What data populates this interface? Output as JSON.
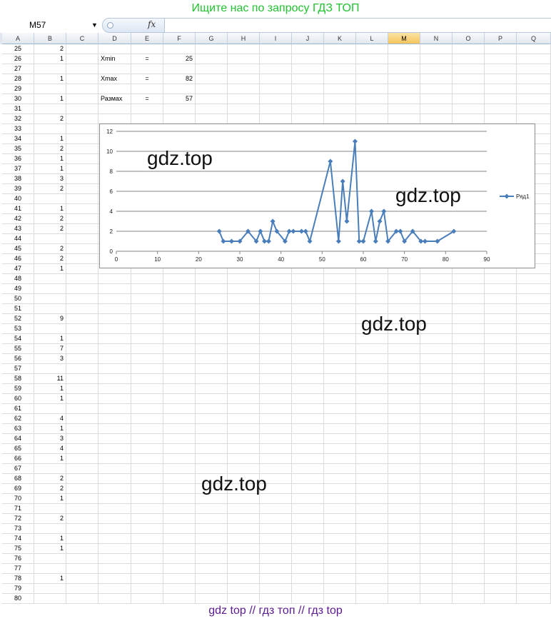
{
  "banner": "Ищите нас по запросу ГДЗ ТОП",
  "formula_bar": {
    "name_box": "M57",
    "fx_label": "fx",
    "formula_value": ""
  },
  "columns": [
    "A",
    "B",
    "C",
    "D",
    "E",
    "F",
    "G",
    "H",
    "I",
    "J",
    "K",
    "L",
    "M",
    "N",
    "O",
    "P",
    "Q"
  ],
  "active_column": "M",
  "rows": [
    {
      "n": "25",
      "b": "2"
    },
    {
      "n": "26",
      "b": "1",
      "d": "Xmin",
      "e": "=",
      "f": "25"
    },
    {
      "n": "27"
    },
    {
      "n": "28",
      "b": "1",
      "d": "Xmax",
      "e": "=",
      "f": "82"
    },
    {
      "n": "29"
    },
    {
      "n": "30",
      "b": "1",
      "d": "Размах",
      "e": "=",
      "f": "57"
    },
    {
      "n": "31"
    },
    {
      "n": "32",
      "b": "2"
    },
    {
      "n": "33"
    },
    {
      "n": "34",
      "b": "1"
    },
    {
      "n": "35",
      "b": "2"
    },
    {
      "n": "36",
      "b": "1"
    },
    {
      "n": "37",
      "b": "1"
    },
    {
      "n": "38",
      "b": "3"
    },
    {
      "n": "39",
      "b": "2"
    },
    {
      "n": "40"
    },
    {
      "n": "41",
      "b": "1"
    },
    {
      "n": "42",
      "b": "2"
    },
    {
      "n": "43",
      "b": "2"
    },
    {
      "n": "44"
    },
    {
      "n": "45",
      "b": "2"
    },
    {
      "n": "46",
      "b": "2"
    },
    {
      "n": "47",
      "b": "1"
    },
    {
      "n": "48"
    },
    {
      "n": "49"
    },
    {
      "n": "50"
    },
    {
      "n": "51"
    },
    {
      "n": "52",
      "b": "9"
    },
    {
      "n": "53"
    },
    {
      "n": "54",
      "b": "1"
    },
    {
      "n": "55",
      "b": "7"
    },
    {
      "n": "56",
      "b": "3"
    },
    {
      "n": "57"
    },
    {
      "n": "58",
      "b": "11"
    },
    {
      "n": "59",
      "b": "1"
    },
    {
      "n": "60",
      "b": "1"
    },
    {
      "n": "61"
    },
    {
      "n": "62",
      "b": "4"
    },
    {
      "n": "63",
      "b": "1"
    },
    {
      "n": "64",
      "b": "3"
    },
    {
      "n": "65",
      "b": "4"
    },
    {
      "n": "66",
      "b": "1"
    },
    {
      "n": "67"
    },
    {
      "n": "68",
      "b": "2"
    },
    {
      "n": "69",
      "b": "2"
    },
    {
      "n": "70",
      "b": "1"
    },
    {
      "n": "71"
    },
    {
      "n": "72",
      "b": "2"
    },
    {
      "n": "73"
    },
    {
      "n": "74",
      "b": "1"
    },
    {
      "n": "75",
      "b": "1"
    },
    {
      "n": "76"
    },
    {
      "n": "77"
    },
    {
      "n": "78",
      "b": "1"
    },
    {
      "n": "79"
    },
    {
      "n": "80"
    }
  ],
  "chart_data": {
    "type": "line",
    "series": [
      {
        "name": "Ряд1",
        "color": "#4a7ebb",
        "x": [
          25,
          26,
          28,
          30,
          32,
          34,
          35,
          36,
          37,
          38,
          39,
          41,
          42,
          43,
          45,
          46,
          47,
          52,
          54,
          55,
          56,
          58,
          59,
          60,
          62,
          63,
          64,
          65,
          66,
          68,
          69,
          70,
          72,
          74,
          75,
          78,
          82
        ],
        "y": [
          2,
          1,
          1,
          1,
          2,
          1,
          2,
          1,
          1,
          3,
          2,
          1,
          2,
          2,
          2,
          2,
          1,
          9,
          1,
          7,
          3,
          11,
          1,
          1,
          4,
          1,
          3,
          4,
          1,
          2,
          2,
          1,
          2,
          1,
          1,
          1,
          2
        ]
      }
    ],
    "xlim": [
      0,
      90
    ],
    "ylim": [
      0,
      12
    ],
    "x_ticks": [
      "0",
      "10",
      "20",
      "30",
      "40",
      "50",
      "60",
      "70",
      "80",
      "90"
    ],
    "y_ticks": [
      "0",
      "2",
      "4",
      "6",
      "8",
      "10",
      "12"
    ],
    "grid": "horizontal",
    "legend": "right"
  },
  "watermarks": [
    "gdz.top",
    "gdz.top",
    "gdz.top",
    "gdz.top"
  ],
  "footer": "gdz top  //  гдз топ  //  гдз top"
}
